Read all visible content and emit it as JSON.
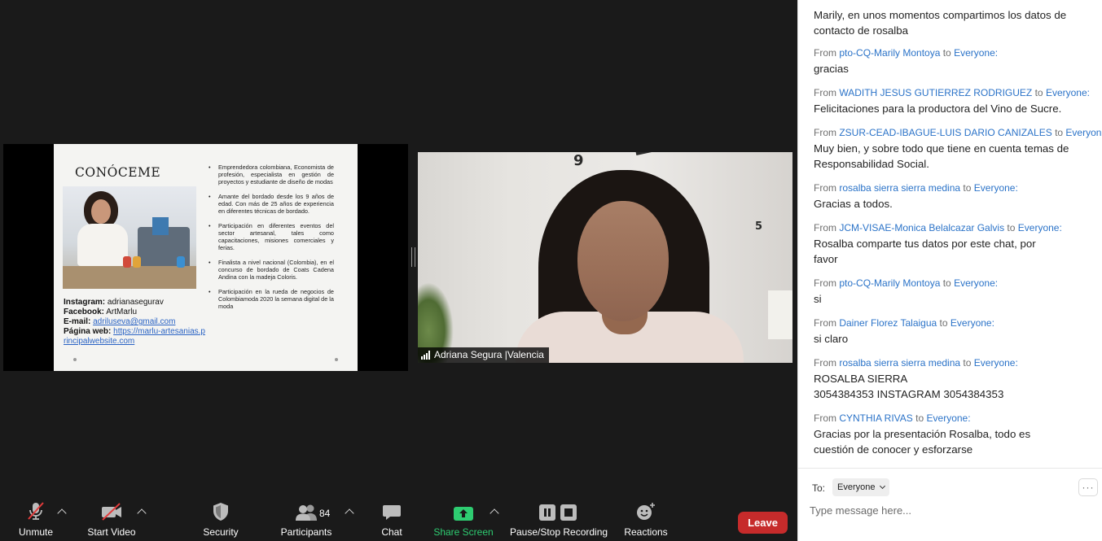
{
  "slide": {
    "title": "CONÓCEME",
    "bullets": [
      "Emprendedora colombiana, Economista de profesión, especialista en gestión de proyectos y estudiante de diseño de modas",
      "Amante del bordado desde los 9 años de edad. Con más de 25 años de experiencia en diferentes técnicas de bordado.",
      "Participación en diferentes eventos del sector artesanal, tales como capacitaciones, misiones comerciales y ferias.",
      "Finalista a nivel nacional (Colombia), en el concurso de bordado de Coats Cadena Andina con la madeja Coloris.",
      "Participación en la rueda de negocios de Colombiamoda 2020 la semana digital de la moda"
    ],
    "contact": {
      "instagram_label": "Instagram:",
      "instagram_value": "adrianasegurav",
      "facebook_label": "Facebook:",
      "facebook_value": "ArtMarlu",
      "email_label": "E-mail:",
      "email_value": "adriluseva@gmail.com",
      "web_label": "Página web:",
      "web_value": "https://marlu-artesanias.principalwebsite.com"
    }
  },
  "video": {
    "participant_name": "Adriana Segura |Valencia",
    "wall_numbers": [
      "9",
      "5"
    ]
  },
  "toolbar": {
    "unmute": "Unmute",
    "start_video": "Start Video",
    "security": "Security",
    "participants": "Participants",
    "participants_count": "84",
    "chat": "Chat",
    "share_screen": "Share Screen",
    "recording": "Pause/Stop Recording",
    "reactions": "Reactions",
    "leave": "Leave"
  },
  "chat": {
    "from_word": "From",
    "to_word": "to",
    "messages": [
      {
        "sender": "",
        "recipient": "",
        "text": "Marily, en unos momentos compartimos los datos de contacto de rosalba"
      },
      {
        "sender": "pto-CQ-Marily Montoya",
        "recipient": "Everyone:",
        "text": "gracias"
      },
      {
        "sender": "WADITH JESUS GUTIERREZ RODRIGUEZ",
        "recipient": "Everyone:",
        "text": "Felicitaciones para la productora del Vino de Sucre."
      },
      {
        "sender": "ZSUR-CEAD-IBAGUE-LUIS DARIO CANIZALES",
        "recipient": "Everyone:",
        "text": "Muy bien, y sobre todo que tiene en cuenta temas de Responsabilidad Social."
      },
      {
        "sender": "rosalba sierra sierra medina",
        "recipient": "Everyone:",
        "text": "Gracias a todos."
      },
      {
        "sender": "JCM-VISAE-Monica Belalcazar Galvis",
        "recipient": "Everyone:",
        "text": "Rosalba comparte tus datos por este chat, por favor"
      },
      {
        "sender": "pto-CQ-Marily Montoya",
        "recipient": "Everyone:",
        "text": "si"
      },
      {
        "sender": "Dainer Florez Talaigua",
        "recipient": "Everyone:",
        "text": "si claro"
      },
      {
        "sender": "rosalba sierra sierra medina",
        "recipient": "Everyone:",
        "text": "ROSALBA SIERRA\n3054384353 INSTAGRAM 3054384353"
      },
      {
        "sender": "CYNTHIA RIVAS",
        "recipient": "Everyone:",
        "text": "Gracias por la presentación Rosalba, todo es cuestión de conocer y esforzarse"
      }
    ],
    "to_label": "To:",
    "to_value": "Everyone",
    "more": "···",
    "input_placeholder": "Type message here..."
  },
  "colors": {
    "leave": "#c62b2b",
    "share_screen": "#2ecc71",
    "sender_link": "#2b73c8"
  }
}
